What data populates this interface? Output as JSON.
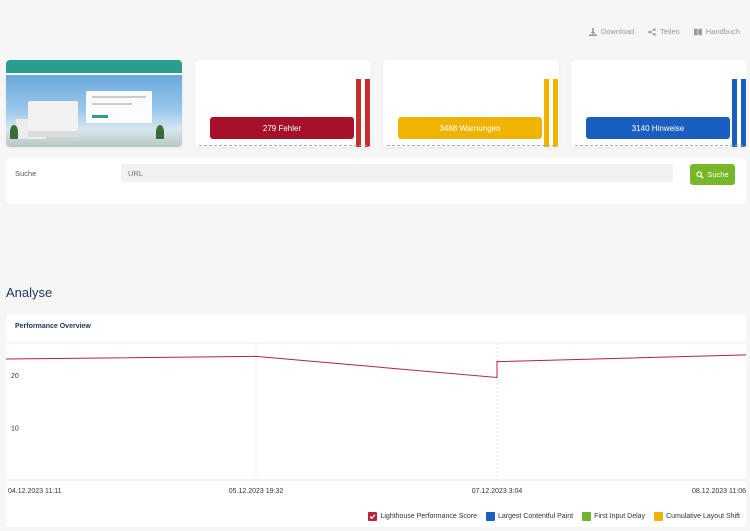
{
  "toolbar": {
    "download_label": "Download",
    "share_label": "Teilen",
    "manual_label": "Handbuch"
  },
  "stats": [
    {
      "label": "279 Fehler",
      "color": "#a5112a",
      "bar_color": "#c62d2d"
    },
    {
      "label": "3488 Warnungen",
      "color": "#f0b400",
      "bar_color": "#f0b400"
    },
    {
      "label": "3140  Hinweise",
      "color": "#1a5fc0",
      "bar_color": "#1a5fc0"
    }
  ],
  "search": {
    "label": "Suche",
    "placeholder": "URL",
    "button_label": "Suche",
    "button_color": "#76b82a"
  },
  "analysis": {
    "section_title": "Analyse",
    "chart_title": "Performance Overview"
  },
  "chart_data": {
    "type": "line",
    "x": [
      "04.12.2023 11:11",
      "05.12.2023 19:32",
      "07.12.2023 3:04",
      "07.12.2023 3:04",
      "08.12.2023 11:06"
    ],
    "x_tick_labels": [
      "04.12.2023 11:11",
      "05.12.2023 19:32",
      "07.12.2023 3:04",
      "08.12.2023 11:06"
    ],
    "y_tick_labels": [
      "20",
      "10"
    ],
    "ylim": [
      0,
      27
    ],
    "grid": "vertical dashed",
    "series": [
      {
        "name": "Lighthouse Performance Score",
        "color": "#b5253d",
        "checked": true,
        "values": [
          23,
          23.5,
          19.5,
          22.5,
          23.8
        ]
      },
      {
        "name": "Largest Contentful Paint",
        "color": "#1a5fc0",
        "checked": false,
        "values": []
      },
      {
        "name": "First Input Delay",
        "color": "#6fb52c",
        "checked": false,
        "values": []
      },
      {
        "name": "Cumulative Layout Shift",
        "color": "#f0b400",
        "checked": false,
        "values": []
      }
    ],
    "legend": "bottom-right"
  }
}
